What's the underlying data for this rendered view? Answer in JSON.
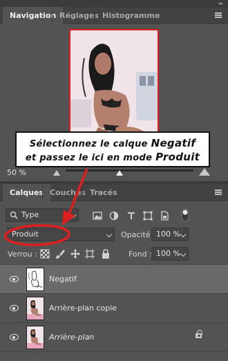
{
  "nav_panel": {
    "tabs": [
      {
        "label": "Navigation",
        "active": true
      },
      {
        "label": "Réglages",
        "active": false
      },
      {
        "label": "Histogramme",
        "active": false
      }
    ],
    "zoom": "50 %",
    "zoom_slider_fraction": 0.42,
    "preview_icon": "image-thumbnail"
  },
  "callout": {
    "line1_a": "Sélectionnez le calque ",
    "line1_b": "Negatif",
    "line2_a": "et passez le ",
    "line2_b": "ici",
    "line2_c": " en mode ",
    "line2_d": "Produit"
  },
  "layers_panel": {
    "tabs": [
      {
        "label": "Calques",
        "active": true
      },
      {
        "label": "Couches",
        "active": false
      },
      {
        "label": "Tracés",
        "active": false
      }
    ],
    "filter": {
      "value": "Type",
      "icon": "search-icon"
    },
    "blend_mode": "Produit",
    "opacity_label": "Opacité :",
    "opacity_value": "100 %",
    "lock_label": "Verrou :",
    "fill_label": "Fond :",
    "fill_value": "100 %",
    "layers": [
      {
        "name": "Negatif",
        "selected": true,
        "italic": false,
        "locked": false
      },
      {
        "name": "Arrière-plan copie",
        "selected": false,
        "italic": false,
        "locked": false
      },
      {
        "name": "Arrière-plan",
        "selected": false,
        "italic": true,
        "locked": true
      }
    ]
  },
  "colors": {
    "annotation_red": "#e01e1e",
    "panel_bg": "#535353",
    "selected_row": "#6a6a6a"
  }
}
